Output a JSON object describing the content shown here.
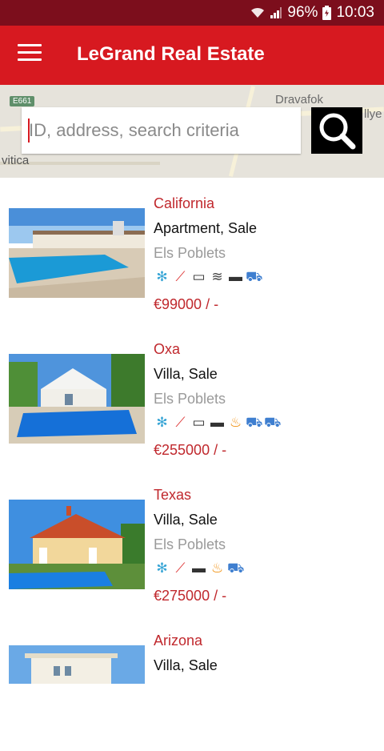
{
  "status_bar": {
    "battery": "96%",
    "time": "10:03"
  },
  "app_bar": {
    "title": "LeGrand Real Estate"
  },
  "map": {
    "labels": [
      "Dravafok",
      "llye",
      "vitica"
    ],
    "badge": "E661"
  },
  "search": {
    "placeholder": "ID, address, search criteria",
    "value": ""
  },
  "listings": [
    {
      "name": "California",
      "type": "Apartment, Sale",
      "location": "Els Poblets",
      "amenities": [
        "fan-icon",
        "thermometer-icon",
        "tv-icon",
        "wifi-icon",
        "monitor-icon",
        "car-icon"
      ],
      "price": "€99000 / -"
    },
    {
      "name": "Oxa",
      "type": "Villa, Sale",
      "location": "Els Poblets",
      "amenities": [
        "fan-icon",
        "thermometer-icon",
        "tv-icon",
        "monitor-icon",
        "fire-icon",
        "car-icon",
        "car-icon"
      ],
      "price": "€255000 / -"
    },
    {
      "name": "Texas",
      "type": "Villa, Sale",
      "location": "Els Poblets",
      "amenities": [
        "fan-icon",
        "thermometer-icon",
        "monitor-icon",
        "fire-icon",
        "car-icon"
      ],
      "price": "€275000 / -"
    },
    {
      "name": "Arizona",
      "type": "Villa, Sale",
      "location": "",
      "amenities": [],
      "price": ""
    }
  ]
}
